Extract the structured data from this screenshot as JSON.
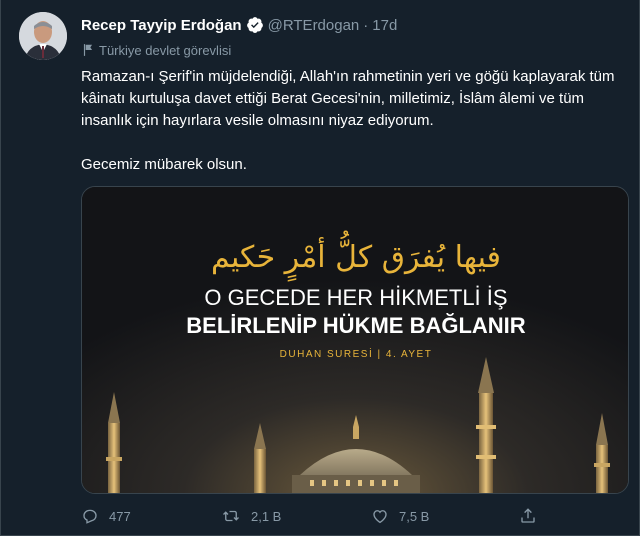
{
  "tweet": {
    "author_name": "Recep Tayyip Erdoğan",
    "handle": "@RTErdogan",
    "separator": "·",
    "time": "17d",
    "account_label": "Türkiye devlet görevlisi",
    "paragraphs": [
      "Ramazan-ı Şerif'in müjdelendiği, Allah'ın rahmetinin yeri ve göğü kaplayarak tüm kâinatı kurtuluşa davet ettiği Berat Gecesi'nin, milletimiz, İslâm âlemi ve tüm insanlık için hayırlara vesile olmasını niyaz ediyorum.",
      "Gecemiz mübarek olsun."
    ],
    "image": {
      "arabic": "فيها يُفرَق كلُّ أمْرٍ حَكيم",
      "line1": "O GECEDE HER HİKMETLİ İŞ",
      "line2": "BELİRLENİP HÜKME BAĞLANIR",
      "source": "DUHAN SURESİ | 4. AYET"
    },
    "actions": {
      "replies": "477",
      "retweets": "2,1 B",
      "likes": "7,5 B"
    }
  },
  "colors": {
    "background": "#15202b",
    "secondary_text": "#8899a6",
    "verified": "#ffffff",
    "gold": "#e8b43a"
  },
  "icons": [
    "verified-badge-icon",
    "flag-icon",
    "reply-icon",
    "retweet-icon",
    "like-icon",
    "share-icon"
  ]
}
